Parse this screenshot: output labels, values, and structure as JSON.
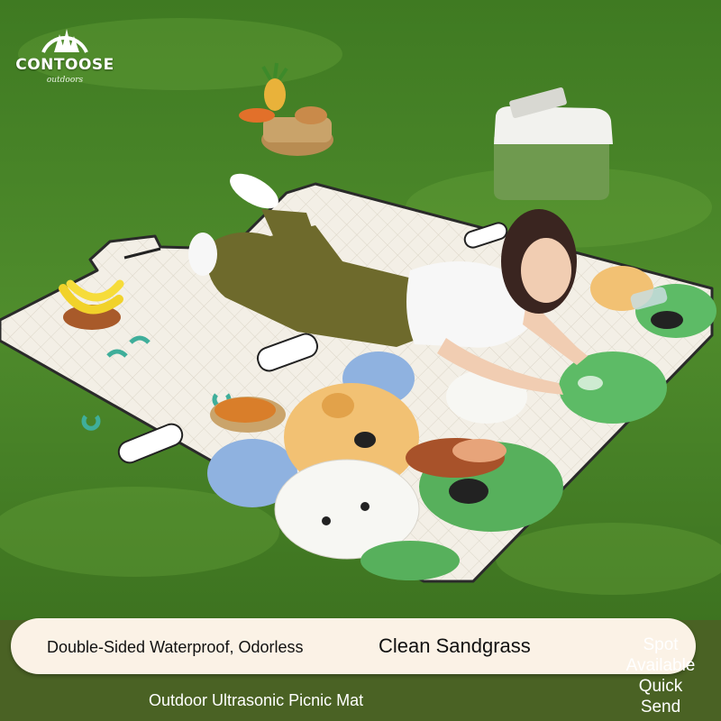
{
  "brand": {
    "logo_text": "CONTOOSE",
    "tagline": "outdoors"
  },
  "banner": {
    "feature_primary": "Double-Sided Waterproof, Odorless",
    "feature_secondary": "Clean Sandgrass",
    "product_name": "Outdoor Ultrasonic Picnic Mat",
    "availability": [
      "Spot",
      "Available",
      "Quick",
      "Send"
    ]
  },
  "colors": {
    "grass": "#4f8a2a",
    "mat_base": "#f3efe6",
    "banner_bg": "#4a6224",
    "pill_bg": "#fbf2e6",
    "cooler_body": "#6f9a4f",
    "cooler_lid": "#f2f2ee"
  }
}
